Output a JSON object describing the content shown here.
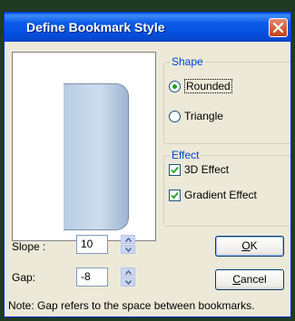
{
  "dialog": {
    "title": "Define Bookmark Style"
  },
  "shape_group": {
    "legend": "Shape",
    "options": [
      {
        "label": "Rounded",
        "selected": true
      },
      {
        "label": "Triangle",
        "selected": false
      }
    ]
  },
  "effect_group": {
    "legend": "Effect",
    "options": [
      {
        "label": "3D Effect",
        "checked": true
      },
      {
        "label": "Gradient Effect",
        "checked": true
      }
    ]
  },
  "slope": {
    "label": "Slope :",
    "value": "10"
  },
  "gap": {
    "label": "Gap:",
    "value": "-8"
  },
  "buttons": {
    "ok": {
      "accel": "O",
      "rest": "K"
    },
    "cancel": {
      "accel": "C",
      "rest": "ancel"
    }
  },
  "note": "Note: Gap refers to the space between bookmarks.",
  "colors": {
    "titlebar": "#0a5ce5",
    "dialog_bg": "#ece9d8",
    "group_legend": "#0046d5",
    "close_button": "#c2410f",
    "bookmark_fill": "#cdddee"
  },
  "icons": {
    "close": "close-icon",
    "spin_up": "chevron-up-icon",
    "spin_down": "chevron-down-icon"
  }
}
